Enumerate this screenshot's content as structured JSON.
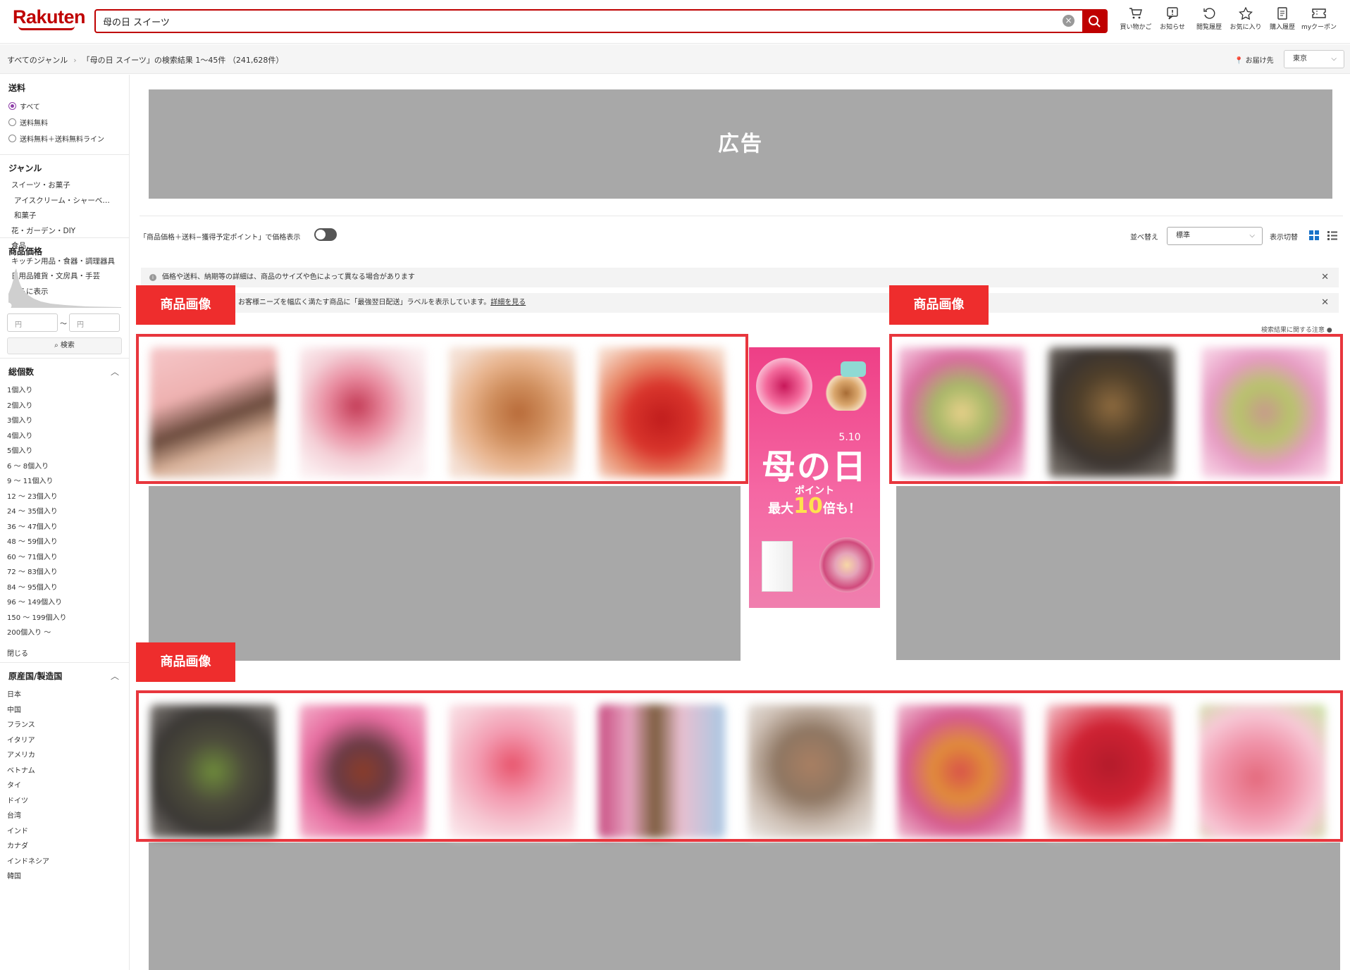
{
  "header": {
    "logo": "Rakuten",
    "search_value": "母の日 スイーツ",
    "icons": [
      {
        "name": "cart-icon",
        "label": "買い物かご"
      },
      {
        "name": "notice-icon",
        "label": "お知らせ"
      },
      {
        "name": "history-icon",
        "label": "閲覧履歴"
      },
      {
        "name": "favorite-icon",
        "label": "お気に入り"
      },
      {
        "name": "purchase-history-icon",
        "label": "購入履歴"
      },
      {
        "name": "coupon-icon",
        "label": "myクーポン"
      }
    ]
  },
  "breadcrumb": {
    "root": "すべてのジャンル",
    "result": "「母の日 スイーツ」の検索結果 1〜45件 （241,628件）"
  },
  "delivery": {
    "label": "お届け先",
    "value": "東京"
  },
  "sidebar": {
    "shipping": {
      "title": "送料",
      "options": [
        "すべて",
        "送料無料",
        "送料無料＋送料無料ライン"
      ]
    },
    "genre": {
      "title": "ジャンル",
      "items": [
        "スイーツ・お菓子",
        "アイスクリーム・シャーベ…",
        "和菓子",
        "花・ガーデン・DIY",
        "食品",
        "キッチン用品・食器・調理器具",
        "日用品雑貨・文房具・手芸",
        "さらに表示"
      ]
    },
    "price": {
      "title": "商品価格",
      "min_placeholder": "円",
      "max_placeholder": "円",
      "tilde": "～",
      "button": "検索"
    },
    "count": {
      "title": "総個数",
      "items": [
        "1個入り",
        "2個入り",
        "3個入り",
        "4個入り",
        "5個入り",
        "6 〜 8個入り",
        "9 〜 11個入り",
        "12 〜 23個入り",
        "24 〜 35個入り",
        "36 〜 47個入り",
        "48 〜 59個入り",
        "60 〜 71個入り",
        "72 〜 83個入り",
        "84 〜 95個入り",
        "96 〜 149個入り",
        "150 〜 199個入り",
        "200個入り 〜"
      ],
      "close": "閉じる"
    },
    "origin": {
      "title": "原産国/製造国",
      "items": [
        "日本",
        "中国",
        "フランス",
        "イタリア",
        "アメリカ",
        "ベトナム",
        "タイ",
        "ドイツ",
        "台湾",
        "インド",
        "カナダ",
        "インドネシア",
        "韓国"
      ]
    }
  },
  "main": {
    "ad_label": "広告",
    "price_toggle_label": "「商品価格＋送料−獲得予定ポイント」で価格表示",
    "sort_label": "並べ替え",
    "sort_value": "標準",
    "view_label": "表示切替",
    "notice1": "価格や送料、納期等の詳細は、商品のサイズや色によって異なる場合があります",
    "notice2": "お客様ニーズを幅広く満たす商品に「最強翌日配送」ラベルを表示しています。",
    "notice2_link": "詳細を見る",
    "search_note": "検索結果に関する注意",
    "product_tag": "商品画像",
    "banner": {
      "date": "5.10",
      "title": "母の日",
      "line1": "ポイント",
      "line2_pre": "最大",
      "line2_num": "10",
      "line2_post": "倍も！"
    }
  },
  "colors": {
    "brand": "#bf0000",
    "annotation_red": "#e8363d",
    "placeholder_gray": "#a8a8a8",
    "banner_pink": "#ee3f86"
  }
}
